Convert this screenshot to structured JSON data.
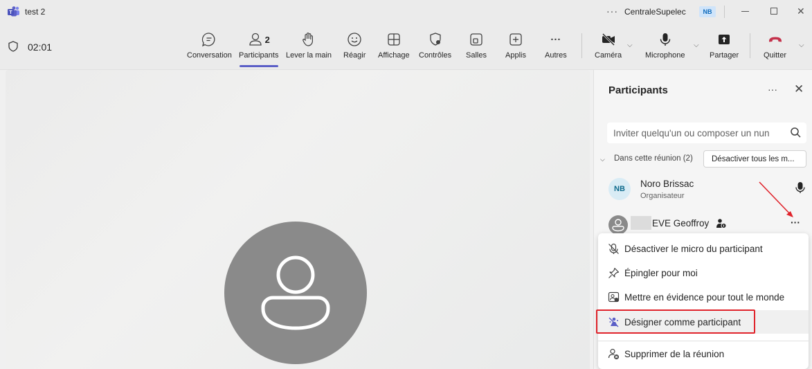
{
  "titlebar": {
    "title": "test 2",
    "more": "···",
    "org": "CentraleSupelec",
    "user_initials": "NB",
    "minimize": "—",
    "close": "✕"
  },
  "toolbar": {
    "timer": "02:01",
    "items": [
      {
        "label": "Conversation",
        "icon": "chat-icon"
      },
      {
        "label": "Participants",
        "icon": "people-icon",
        "count": "2"
      },
      {
        "label": "Lever la main",
        "icon": "hand-icon"
      },
      {
        "label": "Réagir",
        "icon": "smiley-icon"
      },
      {
        "label": "Affichage",
        "icon": "grid-icon"
      },
      {
        "label": "Contrôles",
        "icon": "shield-gear-icon"
      },
      {
        "label": "Salles",
        "icon": "rooms-icon"
      },
      {
        "label": "Applis",
        "icon": "add-app-icon"
      },
      {
        "label": "Autres",
        "icon": "more-icon"
      },
      {
        "label": "Caméra",
        "icon": "camera-off-icon"
      },
      {
        "label": "Microphone",
        "icon": "microphone-icon"
      },
      {
        "label": "Partager",
        "icon": "share-icon"
      },
      {
        "label": "Quitter",
        "icon": "hang-up-icon"
      }
    ],
    "more_glyph": "···"
  },
  "panel": {
    "title": "Participants",
    "more": "···",
    "close": "✕",
    "search_placeholder": "Inviter quelqu'un ou composer un nun",
    "section_label": "Dans cette réunion (2)",
    "mute_all": "Désactiver tous les m...",
    "participants": [
      {
        "initials": "NB",
        "name": "Noro Brissac",
        "role": "Organisateur"
      },
      {
        "name": "EVE Geoffroy"
      }
    ],
    "row_more": "···"
  },
  "context_menu": {
    "items": [
      {
        "label": "Désactiver le micro du participant",
        "icon": "mic-off-icon"
      },
      {
        "label": "Épingler pour moi",
        "icon": "pin-icon"
      },
      {
        "label": "Mettre en évidence pour tout le monde",
        "icon": "spotlight-icon"
      },
      {
        "label": "Désigner comme participant",
        "icon": "attendee-icon"
      },
      {
        "label": "Supprimer de la réunion",
        "icon": "remove-person-icon"
      }
    ]
  },
  "colors": {
    "accent": "#5b5fc7",
    "hangup": "#c4314b",
    "highlight_box": "#e0232b"
  }
}
